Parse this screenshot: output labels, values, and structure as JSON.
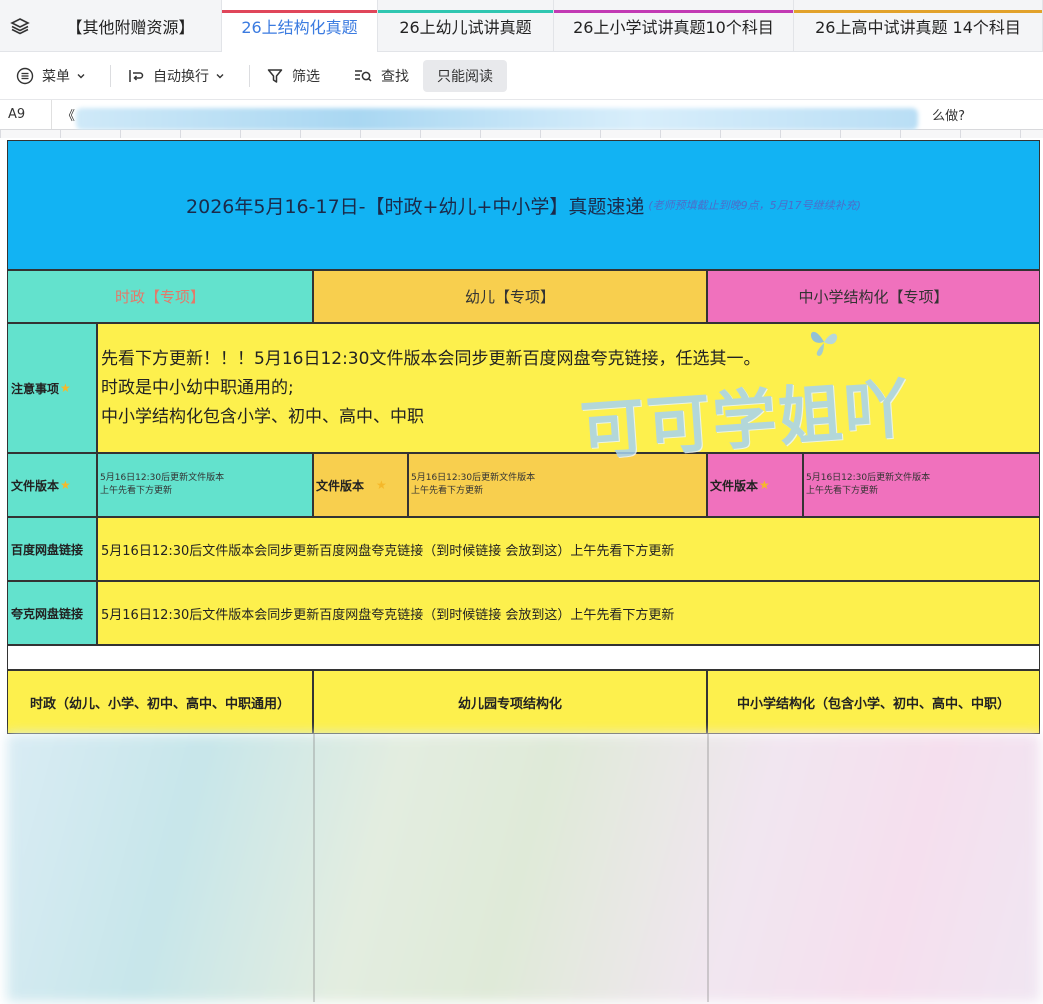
{
  "tabs": {
    "layers_icon": "layers-icon",
    "items": [
      {
        "label": "【其他附赠资源】",
        "bar_color": "",
        "active": false
      },
      {
        "label": "26上结构化真题",
        "bar_color": "#e0465a",
        "active": true
      },
      {
        "label": "26上幼儿试讲真题",
        "bar_color": "#2fc6b1",
        "active": false
      },
      {
        "label": "26上小学试讲真题10个科目",
        "bar_color": "#c23ab4",
        "active": false
      },
      {
        "label": "26上高中试讲真题 14个科目",
        "bar_color": "#e2a22b",
        "active": false
      }
    ]
  },
  "toolbar": {
    "menu_label": "菜单",
    "wrap_label": "自动换行",
    "filter_label": "筛选",
    "find_label": "查找",
    "readonly_label": "只能阅读"
  },
  "formula": {
    "cell_ref": "A9",
    "text_start": "《",
    "text_end": "么做?"
  },
  "sheet": {
    "banner_title": "2026年5月16-17日-【时政+幼儿+中小学】真题速递",
    "banner_note": "(老师预填截止到晚9点，5月17号继续补充)",
    "headers": [
      "时政【专项】",
      "幼儿【专项】",
      "中小学结构化【专项】"
    ],
    "notice_label": "注意事项",
    "notice_lines": [
      "先看下方更新！！！5月16日12:30文件版本会同步更新百度网盘夸克链接，任选其一。",
      "时政是中小幼中职通用的;",
      "中小学结构化包含小学、初中、高中、中职"
    ],
    "file_label": "文件版本",
    "file_line1": "5月16日12:30后更新文件版本",
    "file_line2": "上午先看下方更新",
    "baidu_label": "百度网盘链接",
    "quark_label": "夸克网盘链接",
    "link_text": "5月16日12:30后文件版本会同步更新百度网盘夸克链接（到时候链接 会放到这）上午先看下方更新",
    "subheaders": [
      "时政（幼儿、小学、初中、高中、中职通用）",
      "幼儿园专项结构化",
      "中小学结构化（包含小学、初中、高中、中职）"
    ],
    "watermark": "可可学姐吖"
  },
  "colors": {
    "banner": "#12b3f3",
    "teal": "#63e2cd",
    "orange": "#f8cf4e",
    "pink": "#f071bd",
    "yellow": "#fdf04d",
    "active_tab_text": "#3b7be0"
  }
}
